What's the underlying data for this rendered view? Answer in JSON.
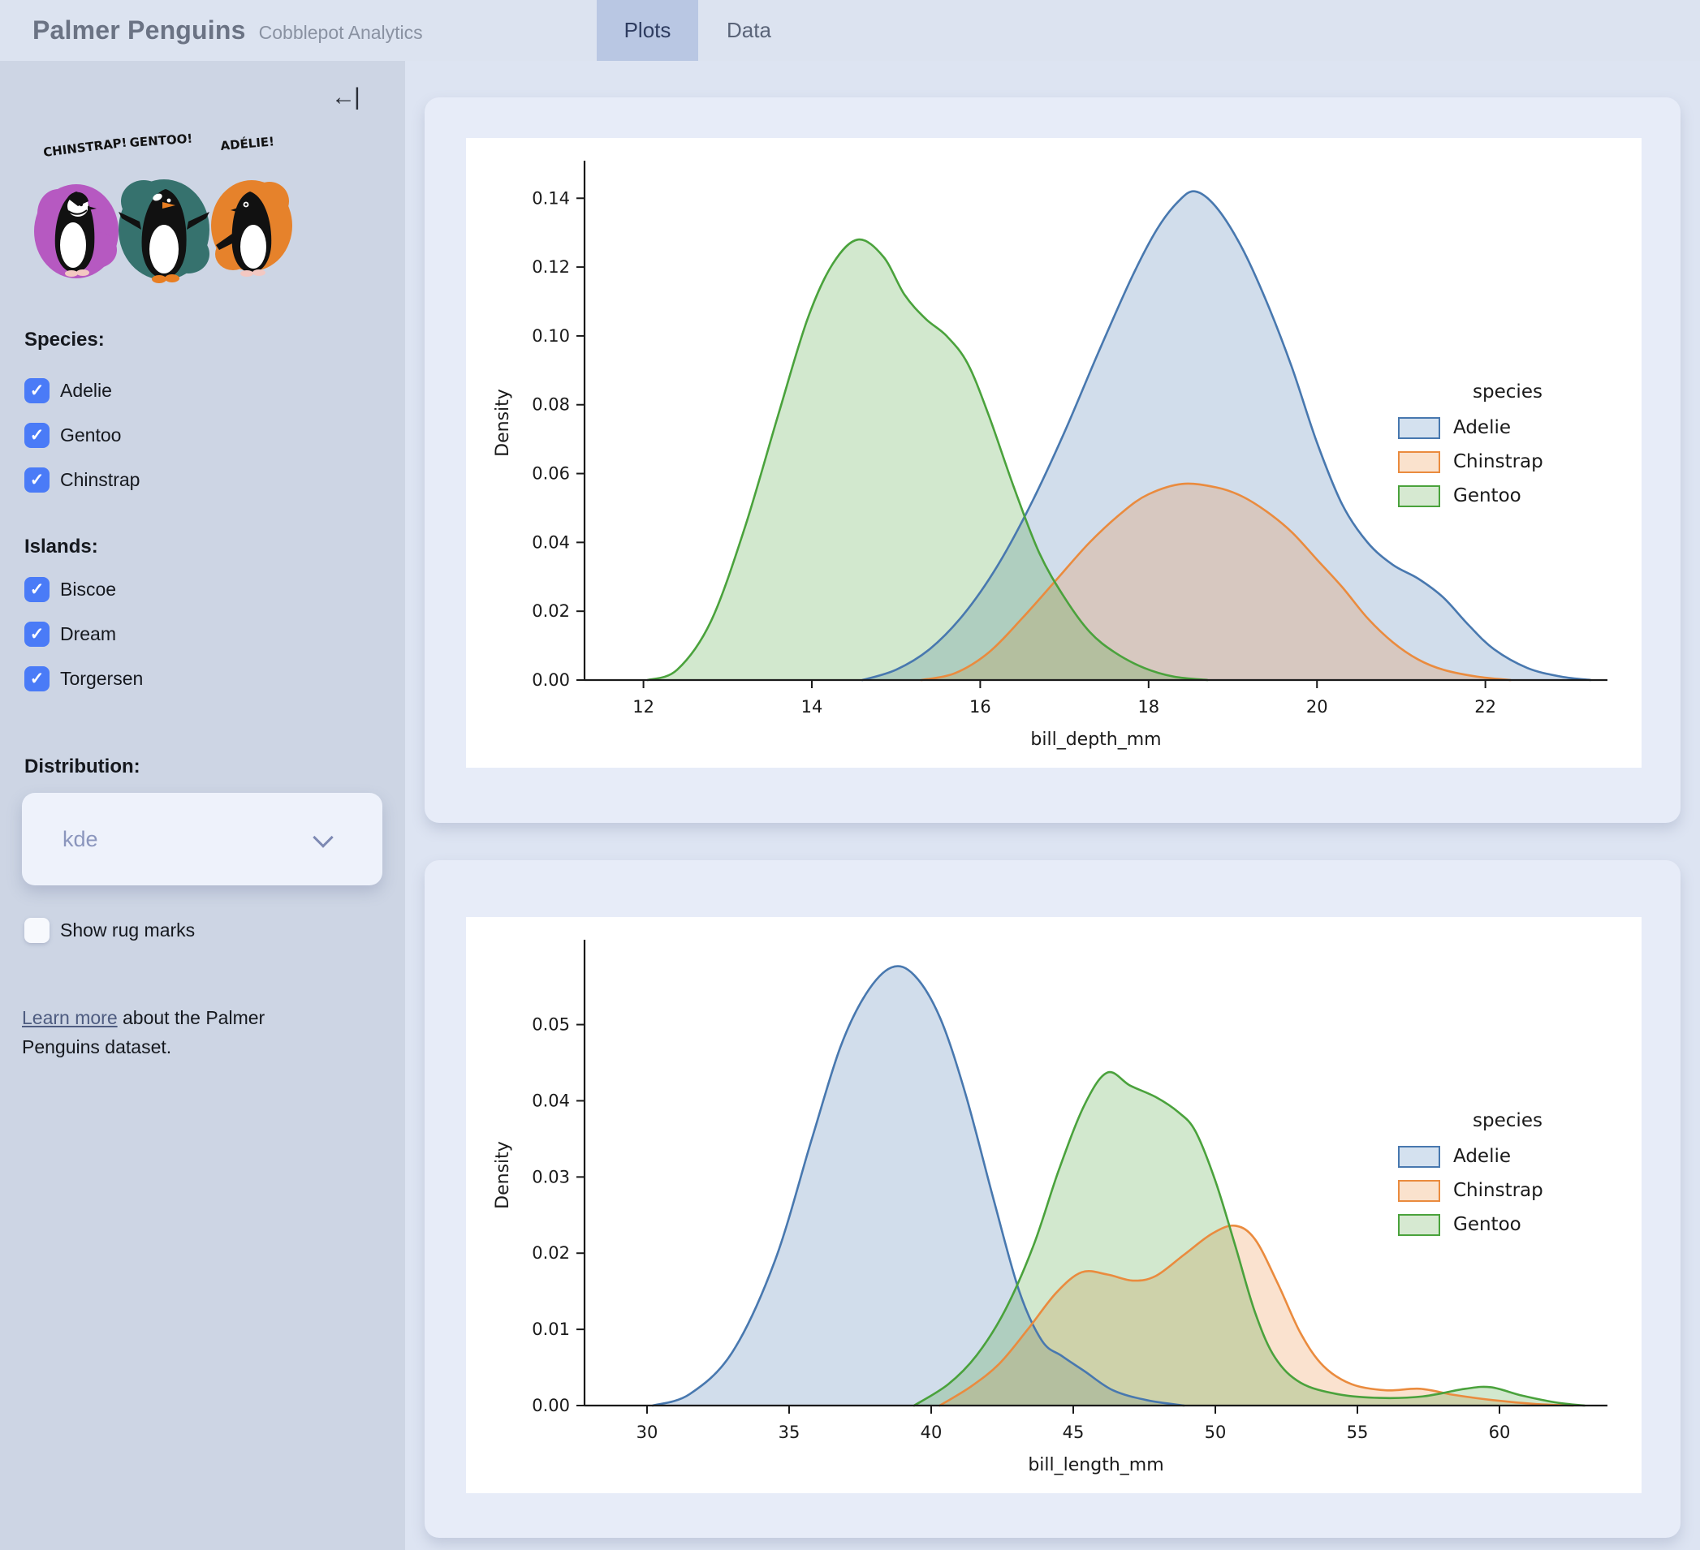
{
  "app": {
    "title": "Palmer Penguins",
    "subtitle": "Cobblepot Analytics"
  },
  "tabs": [
    {
      "label": "Plots",
      "active": true
    },
    {
      "label": "Data",
      "active": false
    }
  ],
  "sidebar": {
    "collapse_icon": "←|",
    "artwork": {
      "labels": [
        "CHINSTRAP!",
        "GENTOO!",
        "ADÉLIE!"
      ],
      "colors": [
        "#b553c0",
        "#2e6d68",
        "#e87e22"
      ]
    },
    "species": {
      "label": "Species:",
      "options": [
        {
          "label": "Adelie",
          "checked": true
        },
        {
          "label": "Gentoo",
          "checked": true
        },
        {
          "label": "Chinstrap",
          "checked": true
        }
      ]
    },
    "islands": {
      "label": "Islands:",
      "options": [
        {
          "label": "Biscoe",
          "checked": true
        },
        {
          "label": "Dream",
          "checked": true
        },
        {
          "label": "Torgersen",
          "checked": true
        }
      ]
    },
    "distribution": {
      "label": "Distribution:",
      "value": "kde"
    },
    "rug": {
      "label": "Show rug marks",
      "checked": false
    },
    "about": {
      "link_text": "Learn more",
      "text_after": " about the Palmer Penguins dataset."
    }
  },
  "legend": {
    "title": "species",
    "entries": [
      {
        "label": "Adelie",
        "line": "#4878af",
        "fill": "#d4e1ef"
      },
      {
        "label": "Chinstrap",
        "line": "#ea8b3e",
        "fill": "#fae2cd"
      },
      {
        "label": "Gentoo",
        "line": "#4aa23c",
        "fill": "#d6e9d1"
      }
    ]
  },
  "chart_data": [
    {
      "type": "area",
      "kind": "kde",
      "title": "",
      "xlabel": "bill_depth_mm",
      "ylabel": "Density",
      "xlim": [
        11.3,
        23.45
      ],
      "ylim": [
        0,
        0.1495
      ],
      "grid": false,
      "legend_position": "center right",
      "xticks": [
        {
          "v": 12,
          "label": "12"
        },
        {
          "v": 14,
          "label": "14"
        },
        {
          "v": 16,
          "label": "16"
        },
        {
          "v": 18,
          "label": "18"
        },
        {
          "v": 20,
          "label": "20"
        },
        {
          "v": 22,
          "label": "22"
        }
      ],
      "yticks": [
        {
          "v": 0.0,
          "label": "0.00"
        },
        {
          "v": 0.02,
          "label": "0.02"
        },
        {
          "v": 0.04,
          "label": "0.04"
        },
        {
          "v": 0.06,
          "label": "0.06"
        },
        {
          "v": 0.08,
          "label": "0.08"
        },
        {
          "v": 0.1,
          "label": "0.10"
        },
        {
          "v": 0.12,
          "label": "0.12"
        },
        {
          "v": 0.14,
          "label": "0.14"
        }
      ],
      "series": [
        {
          "name": "Adelie",
          "color": "#4878af",
          "points": [
            [
              14.6,
              0
            ],
            [
              15.0,
              0.003
            ],
            [
              15.4,
              0.009
            ],
            [
              15.8,
              0.019
            ],
            [
              16.2,
              0.033
            ],
            [
              16.6,
              0.051
            ],
            [
              17.0,
              0.072
            ],
            [
              17.4,
              0.095
            ],
            [
              17.8,
              0.117
            ],
            [
              18.1,
              0.131
            ],
            [
              18.35,
              0.139
            ],
            [
              18.55,
              0.142
            ],
            [
              18.8,
              0.1375
            ],
            [
              19.1,
              0.126
            ],
            [
              19.4,
              0.11
            ],
            [
              19.7,
              0.091
            ],
            [
              20.0,
              0.069
            ],
            [
              20.3,
              0.051
            ],
            [
              20.6,
              0.04
            ],
            [
              20.9,
              0.0335
            ],
            [
              21.2,
              0.0295
            ],
            [
              21.5,
              0.024
            ],
            [
              21.8,
              0.016
            ],
            [
              22.1,
              0.009
            ],
            [
              22.5,
              0.0035
            ],
            [
              22.9,
              0.001
            ],
            [
              23.25,
              0
            ]
          ]
        },
        {
          "name": "Chinstrap",
          "color": "#ea8b3e",
          "points": [
            [
              15.3,
              0
            ],
            [
              15.7,
              0.002
            ],
            [
              16.1,
              0.008
            ],
            [
              16.5,
              0.018
            ],
            [
              16.9,
              0.029
            ],
            [
              17.3,
              0.04
            ],
            [
              17.7,
              0.049
            ],
            [
              18.0,
              0.054
            ],
            [
              18.4,
              0.057
            ],
            [
              18.8,
              0.056
            ],
            [
              19.1,
              0.0535
            ],
            [
              19.4,
              0.049
            ],
            [
              19.7,
              0.043
            ],
            [
              20.0,
              0.035
            ],
            [
              20.3,
              0.027
            ],
            [
              20.6,
              0.018
            ],
            [
              20.9,
              0.011
            ],
            [
              21.2,
              0.006
            ],
            [
              21.5,
              0.003
            ],
            [
              21.9,
              0.001
            ],
            [
              22.3,
              0
            ]
          ]
        },
        {
          "name": "Gentoo",
          "color": "#4aa23c",
          "points": [
            [
              12.05,
              0
            ],
            [
              12.4,
              0.003
            ],
            [
              12.8,
              0.017
            ],
            [
              13.2,
              0.044
            ],
            [
              13.6,
              0.077
            ],
            [
              13.95,
              0.105
            ],
            [
              14.25,
              0.121
            ],
            [
              14.55,
              0.128
            ],
            [
              14.85,
              0.123
            ],
            [
              15.1,
              0.112
            ],
            [
              15.35,
              0.105
            ],
            [
              15.6,
              0.1
            ],
            [
              15.85,
              0.092
            ],
            [
              16.1,
              0.077
            ],
            [
              16.4,
              0.056
            ],
            [
              16.7,
              0.037
            ],
            [
              17.0,
              0.024
            ],
            [
              17.3,
              0.014
            ],
            [
              17.6,
              0.008
            ],
            [
              17.95,
              0.0035
            ],
            [
              18.3,
              0.001
            ],
            [
              18.7,
              0
            ]
          ]
        }
      ]
    },
    {
      "type": "area",
      "kind": "kde",
      "title": "",
      "xlabel": "bill_length_mm",
      "ylabel": "Density",
      "xlim": [
        27.8,
        63.8
      ],
      "ylim": [
        0,
        0.0605
      ],
      "grid": false,
      "legend_position": "center right",
      "xticks": [
        {
          "v": 30,
          "label": "30"
        },
        {
          "v": 35,
          "label": "35"
        },
        {
          "v": 40,
          "label": "40"
        },
        {
          "v": 45,
          "label": "45"
        },
        {
          "v": 50,
          "label": "50"
        },
        {
          "v": 55,
          "label": "55"
        },
        {
          "v": 60,
          "label": "60"
        }
      ],
      "yticks": [
        {
          "v": 0.0,
          "label": "0.00"
        },
        {
          "v": 0.01,
          "label": "0.01"
        },
        {
          "v": 0.02,
          "label": "0.02"
        },
        {
          "v": 0.03,
          "label": "0.03"
        },
        {
          "v": 0.04,
          "label": "0.04"
        },
        {
          "v": 0.05,
          "label": "0.05"
        }
      ],
      "series": [
        {
          "name": "Adelie",
          "color": "#4878af",
          "points": [
            [
              30.2,
              0
            ],
            [
              31.5,
              0.0015
            ],
            [
              33.0,
              0.007
            ],
            [
              34.5,
              0.019
            ],
            [
              35.8,
              0.035
            ],
            [
              36.8,
              0.047
            ],
            [
              37.7,
              0.054
            ],
            [
              38.6,
              0.0575
            ],
            [
              39.4,
              0.0565
            ],
            [
              40.3,
              0.051
            ],
            [
              41.2,
              0.041
            ],
            [
              42.2,
              0.027
            ],
            [
              43.1,
              0.015
            ],
            [
              43.9,
              0.0085
            ],
            [
              44.6,
              0.0065
            ],
            [
              45.4,
              0.0045
            ],
            [
              46.4,
              0.002
            ],
            [
              47.6,
              0.0007
            ],
            [
              48.9,
              0
            ]
          ]
        },
        {
          "name": "Chinstrap",
          "color": "#ea8b3e",
          "points": [
            [
              40.3,
              0
            ],
            [
              41.4,
              0.0025
            ],
            [
              42.4,
              0.0055
            ],
            [
              43.4,
              0.01
            ],
            [
              44.4,
              0.0148
            ],
            [
              45.3,
              0.0175
            ],
            [
              46.2,
              0.0172
            ],
            [
              47.1,
              0.0164
            ],
            [
              47.9,
              0.017
            ],
            [
              48.9,
              0.0198
            ],
            [
              49.9,
              0.0226
            ],
            [
              50.7,
              0.0236
            ],
            [
              51.4,
              0.0218
            ],
            [
              52.2,
              0.016
            ],
            [
              53.0,
              0.0095
            ],
            [
              53.8,
              0.0052
            ],
            [
              54.8,
              0.0028
            ],
            [
              56.0,
              0.002
            ],
            [
              57.2,
              0.0022
            ],
            [
              58.4,
              0.0014
            ],
            [
              59.8,
              0.0007
            ],
            [
              61.3,
              0.0002
            ],
            [
              62.6,
              0
            ]
          ]
        },
        {
          "name": "Gentoo",
          "color": "#4aa23c",
          "points": [
            [
              39.4,
              0
            ],
            [
              40.6,
              0.0028
            ],
            [
              41.6,
              0.0066
            ],
            [
              42.6,
              0.0125
            ],
            [
              43.6,
              0.021
            ],
            [
              44.5,
              0.031
            ],
            [
              45.4,
              0.0395
            ],
            [
              46.2,
              0.0437
            ],
            [
              47.0,
              0.042
            ],
            [
              47.9,
              0.0405
            ],
            [
              48.7,
              0.0385
            ],
            [
              49.3,
              0.036
            ],
            [
              50.0,
              0.0295
            ],
            [
              50.7,
              0.021
            ],
            [
              51.4,
              0.0122
            ],
            [
              52.1,
              0.0063
            ],
            [
              53.0,
              0.003
            ],
            [
              54.3,
              0.0015
            ],
            [
              55.8,
              0.001
            ],
            [
              57.3,
              0.0012
            ],
            [
              58.8,
              0.0022
            ],
            [
              59.7,
              0.0024
            ],
            [
              60.8,
              0.0013
            ],
            [
              62.0,
              0.0004
            ],
            [
              63.0,
              0
            ]
          ]
        }
      ]
    }
  ]
}
